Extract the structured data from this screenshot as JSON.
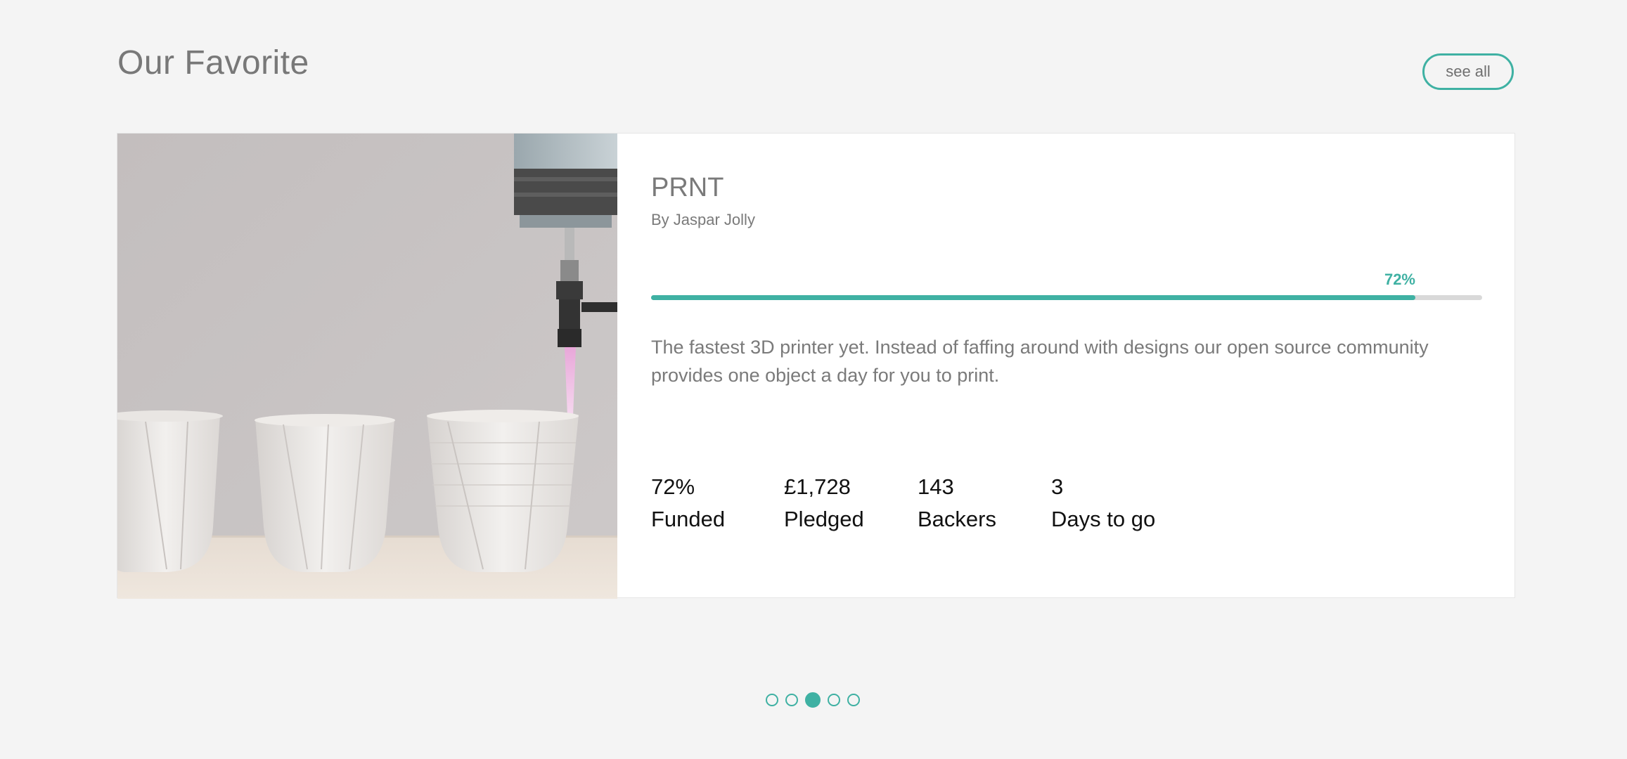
{
  "section": {
    "title": "Our Favorite",
    "see_all_label": "see all"
  },
  "project": {
    "title": "PRNT",
    "author": "By Jaspar Jolly",
    "progress_label": "72%",
    "progress_fraction": 0.92,
    "description": "The fastest 3D printer yet. Instead of faffing around with designs our open source community provides one object a day for you to print.",
    "stats": [
      {
        "value": "72%",
        "label": "Funded"
      },
      {
        "value": "£1,728",
        "label": "Pledged"
      },
      {
        "value": "143",
        "label": "Backers"
      },
      {
        "value": "3",
        "label": "Days to go"
      }
    ],
    "image_icon": "3d-printer-cups-photo"
  },
  "carousel": {
    "page_count": 5,
    "active_index": 2
  },
  "colors": {
    "accent": "#3fb1a3",
    "background": "#f4f4f4",
    "card": "#ffffff",
    "muted_text": "#7a7a7a",
    "dark_text": "#111111",
    "track": "#d9d9d9"
  }
}
